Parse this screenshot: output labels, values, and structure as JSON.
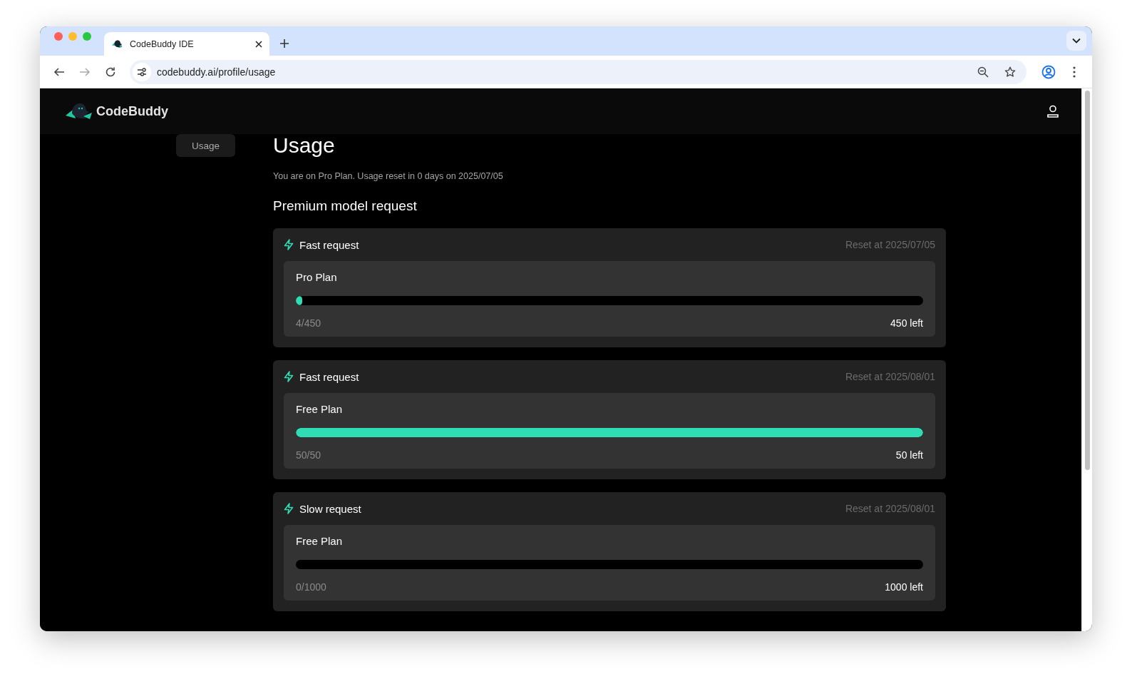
{
  "browser": {
    "tabs": [
      {
        "title": "CodeBuddy IDE",
        "selected": true
      }
    ],
    "address": "codebuddy.ai/profile/usage"
  },
  "header": {
    "brand": "CodeBuddy"
  },
  "sidebar": {
    "items": [
      {
        "label": "Usage",
        "selected": true
      }
    ]
  },
  "page": {
    "title": "Usage",
    "subtitle": "You are on Pro Plan. Usage reset in 0 days on 2025/07/05",
    "section": "Premium model request"
  },
  "cards": [
    {
      "title": "Fast request",
      "reset": "Reset at 2025/07/05",
      "plan": "Pro Plan",
      "level": 0.01,
      "count": "4/450",
      "left": "450 left"
    },
    {
      "title": "Fast request",
      "reset": "Reset at 2025/08/01",
      "plan": "Free Plan",
      "level": 1,
      "count": "50/50",
      "left": "50 left"
    },
    {
      "title": "Slow request",
      "reset": "Reset at 2025/08/01",
      "plan": "Free Plan",
      "level": 0,
      "count": "0/1000",
      "left": "1000 left"
    }
  ]
}
